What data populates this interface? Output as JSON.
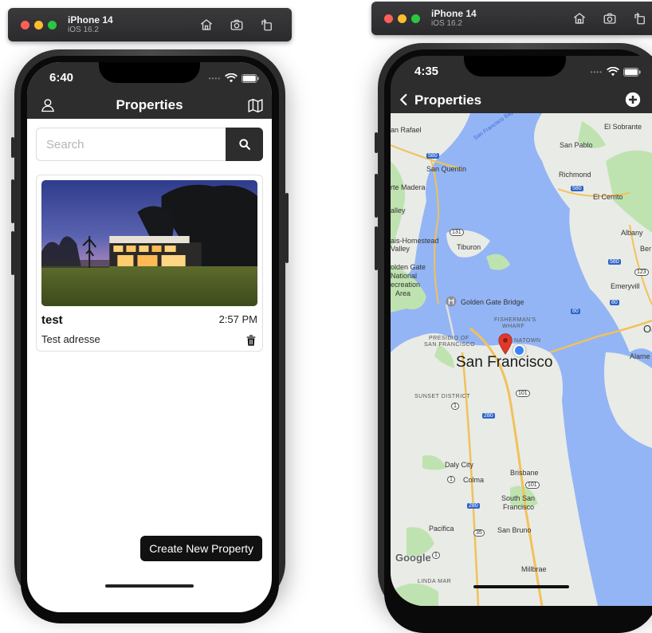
{
  "simulators": [
    {
      "device": "iPhone 14",
      "os": "iOS 16.2"
    },
    {
      "device": "iPhone 14",
      "os": "iOS 16.2"
    }
  ],
  "colors": {
    "close": "#ff5f57",
    "minimize": "#febc2e",
    "zoom": "#28c840",
    "nav": "#2d2d2d",
    "water": "#93b5f5",
    "land": "#e9ebe6",
    "park": "#bfe3b0",
    "pin": "#e0392b",
    "location": "#3b82f6"
  },
  "left": {
    "time": "6:40",
    "nav": {
      "title": "Properties",
      "left_icon": "person-icon",
      "right_icon": "map-icon"
    },
    "search": {
      "placeholder": "Search",
      "value": ""
    },
    "card": {
      "name": "test",
      "time": "2:57 PM",
      "address": "Test adresse"
    },
    "create_button": "Create New Property"
  },
  "right": {
    "time": "4:35",
    "nav": {
      "back_label": "Properties",
      "right_icon": "plus-circle-icon"
    },
    "map": {
      "labels": [
        "an Rafael",
        "San Quentin",
        "San Pablo",
        "El Sobrante",
        "Richmond",
        "El Cerrito",
        "rte Madera",
        "alley",
        "Albany",
        "Ber",
        "ais-Homestead",
        "Valley",
        "Tiburon",
        "olden Gate",
        "National",
        "ecreation",
        "Area",
        "Golden Gate Bridge",
        "Emeryvill",
        "Oa",
        "Alame",
        "San Francisco",
        "Brisbane",
        "South San",
        "Francisco",
        "San Bruno",
        "Millbrae",
        "Pacifica",
        "Daly City",
        "Colma",
        "San Francisco Bay"
      ],
      "small_labels": [
        "FISHERMAN'S",
        "WHARF",
        "PRESIDIO OF",
        "SAN FRANCISCO",
        "NATOWN",
        "SUNSET DISTRICT",
        "LINDA MAR"
      ],
      "shields": [
        "580",
        "580",
        "131",
        "580",
        "123",
        "80",
        "80",
        "101",
        "280",
        "101",
        "280",
        "1",
        "1",
        "35",
        "1"
      ],
      "attribution": "Google"
    }
  }
}
